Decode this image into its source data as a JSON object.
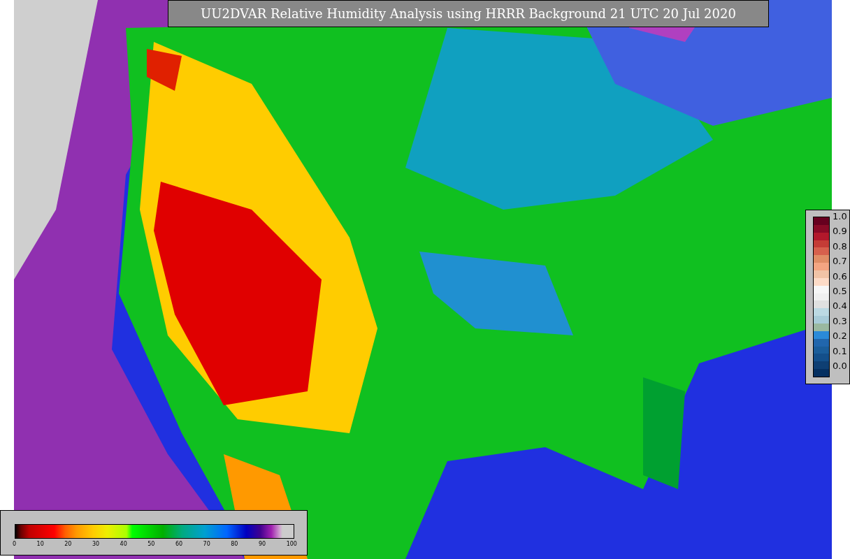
{
  "title": "UU2DVAR Relative Humidity Analysis using HRRR Background 21 UTC 20 Jul 2020",
  "right_colorbar": {
    "ticks": [
      "1.0",
      "0.9",
      "0.8",
      "0.7",
      "0.6",
      "0.5",
      "0.4",
      "0.3",
      "0.2",
      "0.1",
      "0.0"
    ]
  },
  "bottom_colorbar": {
    "ticks": [
      "0",
      "10",
      "20",
      "30",
      "40",
      "50",
      "60",
      "70",
      "80",
      "90",
      "100"
    ]
  }
}
